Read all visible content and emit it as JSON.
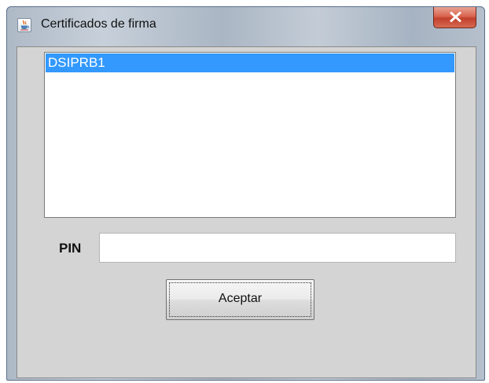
{
  "window": {
    "title": "Certificados de firma",
    "title_icon": "java-cup-icon",
    "close_icon": "close-icon"
  },
  "cert_list": {
    "items": [
      "DSIPRB1"
    ],
    "selected_index": 0
  },
  "pin": {
    "label": "PIN",
    "value": ""
  },
  "accept_button": {
    "label": "Aceptar"
  },
  "colors": {
    "selection": "#3399ff",
    "dialog_background": "#d4d4d4",
    "close_button": "#c2402b"
  }
}
